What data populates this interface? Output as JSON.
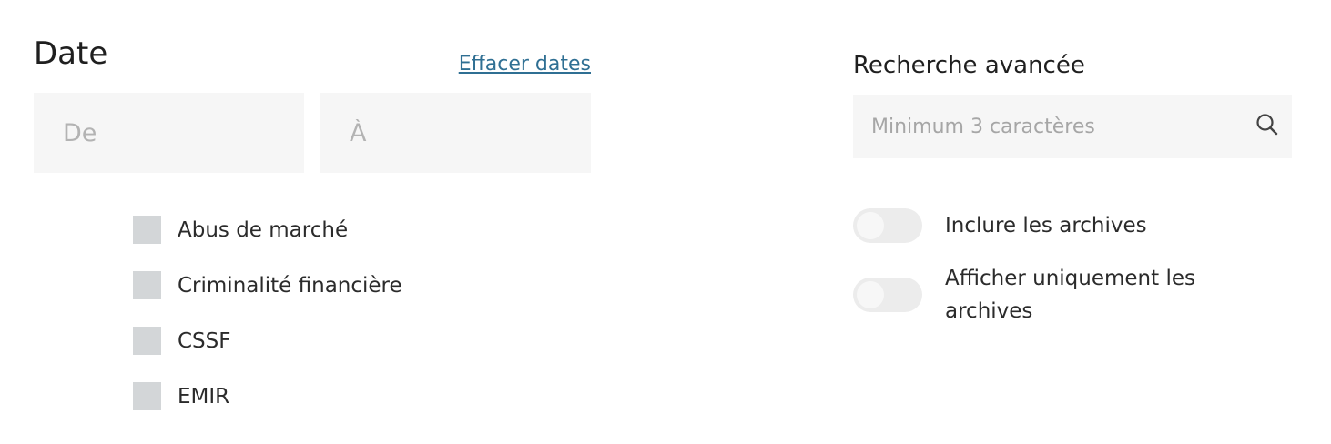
{
  "date": {
    "title": "Date",
    "clear_label": "Effacer dates",
    "from_placeholder": "De",
    "to_placeholder": "À"
  },
  "categories": [
    {
      "label": "Abus de marché",
      "checked": false
    },
    {
      "label": "Criminalité financière",
      "checked": false
    },
    {
      "label": "CSSF",
      "checked": false
    },
    {
      "label": "EMIR",
      "checked": false
    }
  ],
  "advanced_search": {
    "title": "Recherche avancée",
    "placeholder": "Minimum 3 caractères",
    "icon": "search-icon"
  },
  "toggles": {
    "include_archives": {
      "label": "Inclure les archives",
      "on": false
    },
    "only_archives": {
      "label": "Afficher uniquement les archives",
      "on": false
    }
  },
  "colors": {
    "link": "#2f6f93",
    "field_bg": "#f6f6f6",
    "checkbox": "#d3d6d8",
    "toggle_track": "#ececec"
  }
}
